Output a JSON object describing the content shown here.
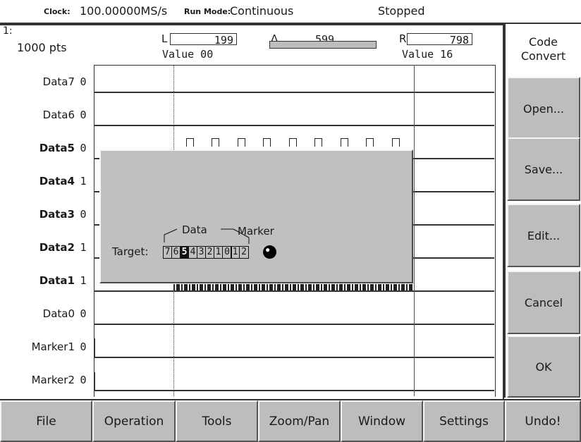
{
  "status": {
    "clock_label": "Clock:",
    "clock_value": "100.00000MS/s",
    "run_mode_label": "Run Mode:",
    "run_mode_value": "Continuous",
    "state": "Stopped"
  },
  "header": {
    "channel": "1:",
    "points": "1000 pts",
    "left_label": "L",
    "left_value": "199",
    "left_value_label": "Value 00",
    "delta_label": "Δ",
    "delta_value": "599",
    "right_label": "R",
    "right_value": "798",
    "right_value_label": "Value 16"
  },
  "rows": [
    {
      "name": "Data7",
      "bit": "0"
    },
    {
      "name": "Data6",
      "bit": "0"
    },
    {
      "name": "Data5",
      "bit": "0"
    },
    {
      "name": "Data4",
      "bit": "1"
    },
    {
      "name": "Data3",
      "bit": "0"
    },
    {
      "name": "Data2",
      "bit": "1"
    },
    {
      "name": "Data1",
      "bit": "1"
    },
    {
      "name": "Data0",
      "bit": "0"
    },
    {
      "name": "Marker1",
      "bit": "0"
    },
    {
      "name": "Marker2",
      "bit": "0"
    }
  ],
  "dialog": {
    "data_label": "Data",
    "marker_label": "Marker",
    "target_label": "Target:",
    "data_bits": [
      "7",
      "6",
      "5",
      "4",
      "3",
      "2",
      "1",
      "0"
    ],
    "marker_bits": [
      "1",
      "2"
    ],
    "selected_bit": "5"
  },
  "side_menu": {
    "title": "Code Convert",
    "buttons": [
      "Open...",
      "Save...",
      "Edit...",
      "Cancel",
      "OK"
    ]
  },
  "bottom_menu": {
    "tabs": [
      "File",
      "Operation",
      "Tools",
      "Zoom/Pan",
      "Window",
      "Settings",
      "Undo!"
    ]
  }
}
